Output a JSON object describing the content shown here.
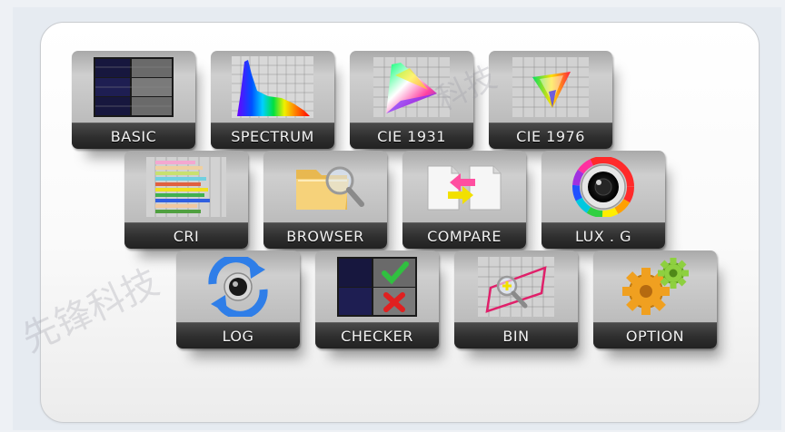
{
  "tiles": [
    {
      "id": "basic",
      "label": "BASIC",
      "icon": "basic-icon"
    },
    {
      "id": "spectrum",
      "label": "SPECTRUM",
      "icon": "spectrum-icon"
    },
    {
      "id": "cie1931",
      "label": "CIE 1931",
      "icon": "cie1931-icon"
    },
    {
      "id": "cie1976",
      "label": "CIE 1976",
      "icon": "cie1976-icon"
    },
    {
      "id": "cri",
      "label": "CRI",
      "icon": "cri-icon"
    },
    {
      "id": "browser",
      "label": "BROWSER",
      "icon": "folder-search-icon"
    },
    {
      "id": "compare",
      "label": "COMPARE",
      "icon": "compare-icon"
    },
    {
      "id": "luxg",
      "label": "LUX . G",
      "icon": "color-wheel-camera-icon"
    },
    {
      "id": "log",
      "label": "LOG",
      "icon": "sync-camera-icon"
    },
    {
      "id": "checker",
      "label": "CHECKER",
      "icon": "check-cross-icon"
    },
    {
      "id": "bin",
      "label": "BIN",
      "icon": "bin-area-icon"
    },
    {
      "id": "option",
      "label": "OPTION",
      "icon": "gears-icon"
    }
  ],
  "watermark": {
    "text_left": "先锋科技",
    "text_top": "科技"
  }
}
